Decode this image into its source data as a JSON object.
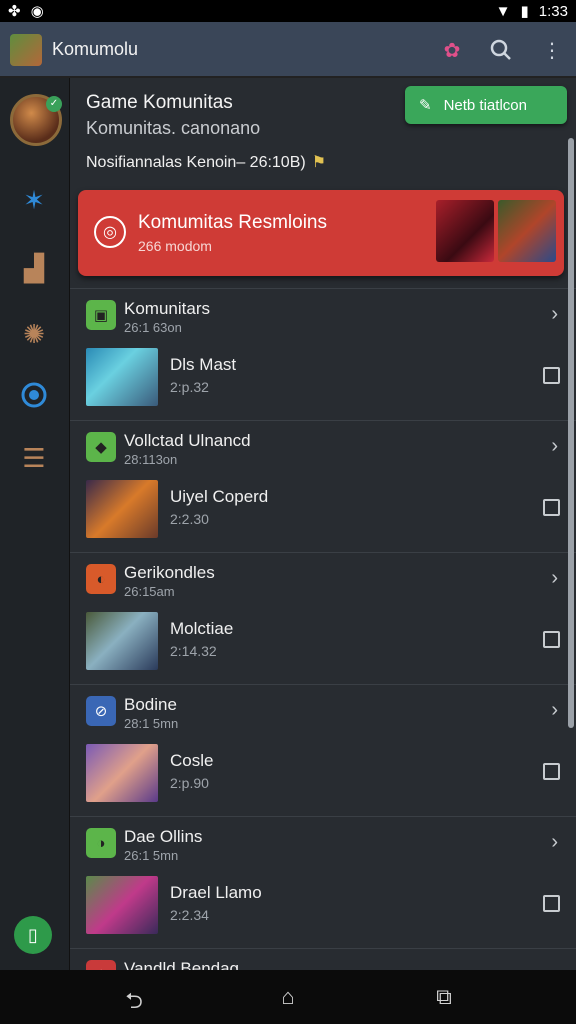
{
  "status_bar": {
    "time": "1:33",
    "icons": [
      "gamepad-icon",
      "lock-icon",
      "wifi-icon",
      "battery-icon"
    ]
  },
  "app_bar": {
    "title": "Komumolu",
    "icons": [
      "gift-icon",
      "search-icon",
      "overflow-menu-icon"
    ]
  },
  "sidebar": {
    "items": [
      "avatar",
      "star-icon",
      "boot-icon",
      "shield-icon",
      "chat-icon",
      "list-icon"
    ],
    "fab_icon": "clipboard-icon"
  },
  "header": {
    "title": "Game Komunitas",
    "subtitle": "Komunitas. canonano",
    "note": "Nosifiannalas Kenoin– 26:10B)",
    "action_label": "Netb tiatlcon"
  },
  "featured": {
    "title": "Komumitas Resmloins",
    "subtitle": "266 modom",
    "color": "#cf3b36"
  },
  "groups": [
    {
      "title": "Komunitars",
      "time": "26:1 63on",
      "icon_color": "#5cb54a",
      "items": [
        {
          "title": "Dls Mast",
          "time": "2:p.32"
        }
      ]
    },
    {
      "title": "Vollctad Ulnancd",
      "time": "28:113on",
      "icon_color": "#5cb54a",
      "items": [
        {
          "title": "Uiyel Coperd",
          "time": "2:2.30"
        }
      ]
    },
    {
      "title": "Gerikondles",
      "time": "26:15am",
      "icon_color": "#d85a2a",
      "items": [
        {
          "title": "Molctiae",
          "time": "2:14.32"
        }
      ]
    },
    {
      "title": "Bodine",
      "time": "28:1 5mn",
      "icon_color": "#3a67b5",
      "items": [
        {
          "title": "Cosle",
          "time": "2:p.90"
        }
      ]
    },
    {
      "title": "Dae Ollins",
      "time": "26:1 5mn",
      "icon_color": "#5cb54a",
      "items": [
        {
          "title": "Drael Llamo",
          "time": "2:2.34"
        }
      ]
    },
    {
      "title": "Vandld Bendag",
      "time": "",
      "icon_color": "#c93a3a",
      "items": []
    }
  ],
  "colors": {
    "accent_green": "#3aa75a",
    "header_bg": "#3a4658",
    "content_bg": "#282c31"
  }
}
